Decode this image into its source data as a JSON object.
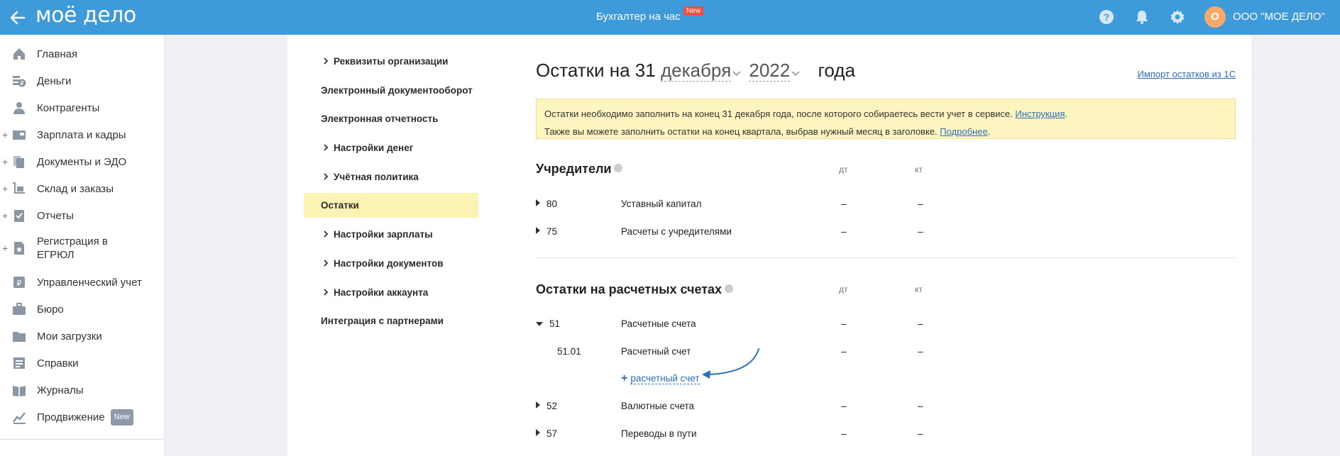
{
  "topbar": {
    "logo": "моё дело",
    "center_title": "Бухгалтер на час",
    "center_badge": "New",
    "avatar_letter": "О",
    "company": "ООО \"МОЕ ДЕЛО\"",
    "bg_color": "#3f9ad9"
  },
  "sidebar": {
    "items": [
      {
        "label": "Главная",
        "icon": "home-icon",
        "plus": false
      },
      {
        "label": "Деньги",
        "icon": "money-icon",
        "plus": false
      },
      {
        "label": "Контрагенты",
        "icon": "contractors-icon",
        "plus": false
      },
      {
        "label": "Зарплата и кадры",
        "icon": "salary-icon",
        "plus": true
      },
      {
        "label": "Документы и ЭДО",
        "icon": "documents-icon",
        "plus": true
      },
      {
        "label": "Склад и заказы",
        "icon": "warehouse-icon",
        "plus": true
      },
      {
        "label": "Отчеты",
        "icon": "reports-icon",
        "plus": true
      },
      {
        "label": "Регистрация в ЕГРЮЛ",
        "icon": "registration-icon",
        "plus": true
      },
      {
        "label": "Управленческий учет",
        "icon": "management-icon",
        "plus": false
      },
      {
        "label": "Бюро",
        "icon": "bureau-icon",
        "plus": false
      },
      {
        "label": "Мои загрузки",
        "icon": "uploads-icon",
        "plus": false
      },
      {
        "label": "Справки",
        "icon": "certificates-icon",
        "plus": false
      },
      {
        "label": "Журналы",
        "icon": "journals-icon",
        "plus": false
      },
      {
        "label": "Продвижение",
        "icon": "promotion-icon",
        "plus": false,
        "badge": "New"
      }
    ]
  },
  "settings_menu": [
    {
      "label": "Реквизиты организации",
      "chevron": true,
      "active": false
    },
    {
      "label": "Электронный документооборот",
      "chevron": false,
      "active": false
    },
    {
      "label": "Электронная отчетность",
      "chevron": false,
      "active": false
    },
    {
      "label": "Настройки денег",
      "chevron": true,
      "active": false
    },
    {
      "label": "Учётная политика",
      "chevron": true,
      "active": false
    },
    {
      "label": "Остатки",
      "chevron": false,
      "active": true
    },
    {
      "label": "Настройки зарплаты",
      "chevron": true,
      "active": false
    },
    {
      "label": "Настройки документов",
      "chevron": true,
      "active": false
    },
    {
      "label": "Настройки аккаунта",
      "chevron": true,
      "active": false
    },
    {
      "label": "Интеграция с партнерами",
      "chevron": false,
      "active": false
    }
  ],
  "main": {
    "heading_prefix": "Остатки на 31",
    "month": "декабря",
    "year": "2022",
    "heading_suffix": "года",
    "import_link": "Импорт остатков из 1С",
    "notice": {
      "line1": "Остатки необходимо заполнить на конец 31 декабря года, после которого собираетесь вести учет в сервисе.",
      "line1_link": "Инструкция",
      "line2": "Также вы можете заполнить остатки на конец квартала, выбрав нужный месяц в заголовке.",
      "line2_link": "Подробнее"
    },
    "col_dt": "дт",
    "col_kt": "кт",
    "founders": {
      "title": "Учредители",
      "rows": [
        {
          "code": "80",
          "name": "Уставный капитал",
          "dt": "–",
          "kt": "–"
        },
        {
          "code": "75",
          "name": "Расчеты с учредителями",
          "dt": "–",
          "kt": "–"
        }
      ]
    },
    "accounts": {
      "title": "Остатки на расчетных счетах",
      "rows": [
        {
          "code": "51",
          "name": "Расчетные счета",
          "dt": "–",
          "kt": "–",
          "expanded": true
        },
        {
          "code": "51.01",
          "name": "Расчетный счет",
          "dt": "–",
          "kt": "–",
          "sub": true
        },
        {
          "code": "52",
          "name": "Валютные счета",
          "dt": "–",
          "kt": "–"
        },
        {
          "code": "57",
          "name": "Переводы в пути",
          "dt": "–",
          "kt": "–"
        }
      ],
      "add_label": "расчетный счет"
    }
  }
}
